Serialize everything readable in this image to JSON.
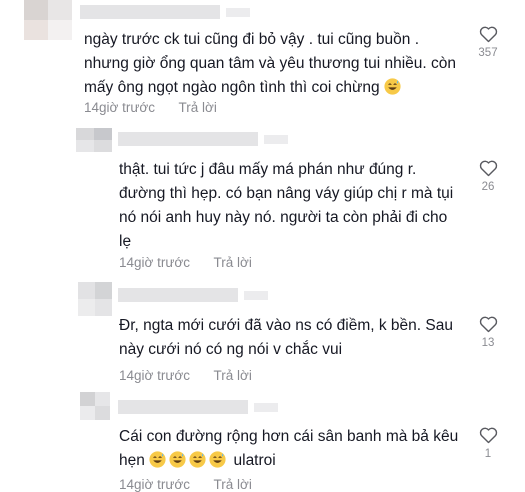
{
  "comments": [
    {
      "text": "ngày trước ck tui cũng đi bỏ vậy . tui cũng buồn .\nnhưng giờ ổng quan tâm và yêu thương tui nhiều. còn\nmấy ông ngọt ngào ngôn tình thì coi chừng",
      "emoji_count": 1,
      "time": "14giờ trước",
      "reply": "Trả lời",
      "likes": "357"
    },
    {
      "text": "thật. tui tức j đâu mấy má phán như đúng r.\nđường thì hẹp. có bạn nâng váy giúp chị r mà tụi\nnó nói anh huy này nó. người ta còn phải đi cho\nlẹ",
      "emoji_count": 0,
      "time": "14giờ trước",
      "reply": "Trả lời",
      "likes": "26"
    },
    {
      "text": "Đr, ngta mới cưới đã vào ns có điềm, k bền. Sau\nnày cưới nó có ng nói v chắc vui",
      "emoji_count": 0,
      "time": "14giờ trước",
      "reply": "Trả lời",
      "likes": "13"
    },
    {
      "text": "Cái con đường rộng hơn cái sân banh mà bả kêu\nhẹn",
      "text_after_emoji": "ulatroi",
      "emoji_count": 4,
      "time": "14giờ trước",
      "reply": "Trả lời",
      "likes": "1"
    }
  ],
  "emoji_icon": "grinning-sweat-emoji",
  "colors": {
    "text": "#161823",
    "muted": "#8a8b91",
    "emoji": "#f7c948"
  }
}
